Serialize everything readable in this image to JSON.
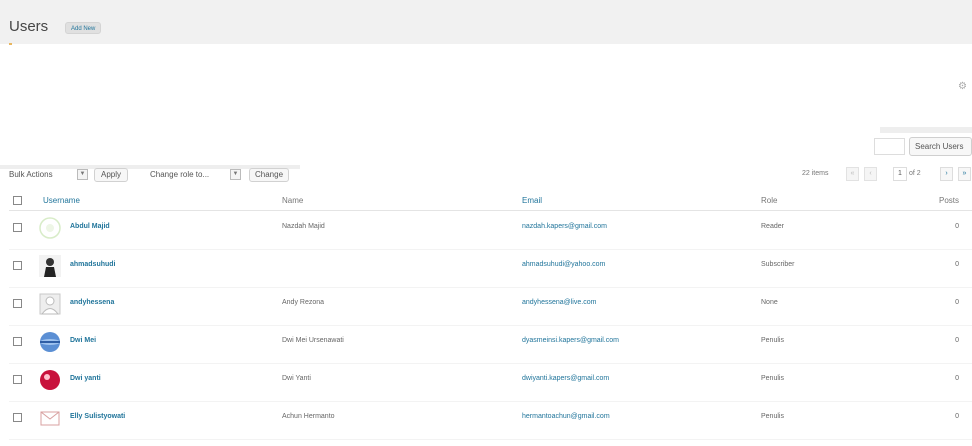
{
  "header": {
    "title": "Users",
    "add_new_label": "Add New"
  },
  "screen_options": {
    "icon": "gear-icon"
  },
  "search": {
    "button_label": "Search Users",
    "value": ""
  },
  "tablenav": {
    "bulk_actions_label": "Bulk Actions",
    "apply_label": "Apply",
    "change_role_label": "Change role to...",
    "change_label": "Change",
    "items_count": "22 items",
    "first_page": "«",
    "prev_page": "‹",
    "current_page": "1",
    "page_total": "of 2",
    "next_page": "›",
    "last_page": "»"
  },
  "table": {
    "columns": {
      "username": "Username",
      "name": "Name",
      "email": "Email",
      "role": "Role",
      "posts": "Posts"
    },
    "rows": [
      {
        "username": "Abdul Majid",
        "name": "Nazdah Majid",
        "email": "nazdah.kapers@gmail.com",
        "role": "Reader",
        "posts": "0",
        "avatar": "identicon-avatar"
      },
      {
        "username": "ahmadsuhudi",
        "name": "",
        "email": "ahmadsuhudi@yahoo.com",
        "role": "Subscriber",
        "posts": "0",
        "avatar": "photo-avatar"
      },
      {
        "username": "andyhessena",
        "name": "Andy Rezona",
        "email": "andyhessena@live.com",
        "role": "None",
        "posts": "0",
        "avatar": "default-avatar"
      },
      {
        "username": "Dwi Mei",
        "name": "Dwi Mei Ursenawati",
        "email": "dyasmeinsi.kapers@gmail.com",
        "role": "Penulis",
        "posts": "0",
        "avatar": "globe-avatar"
      },
      {
        "username": "Dwi yanti",
        "name": "Dwi Yanti",
        "email": "dwiyanti.kapers@gmail.com",
        "role": "Penulis",
        "posts": "0",
        "avatar": "red-avatar"
      },
      {
        "username": "Elly Sulistyowati",
        "name": "Achun Hermanto",
        "email": "hermantoachun@gmail.com",
        "role": "Penulis",
        "posts": "0",
        "avatar": "envelope-avatar"
      }
    ]
  },
  "colors": {
    "link": "#21759b",
    "header_bg": "#f1f1f1",
    "text": "#555555"
  }
}
